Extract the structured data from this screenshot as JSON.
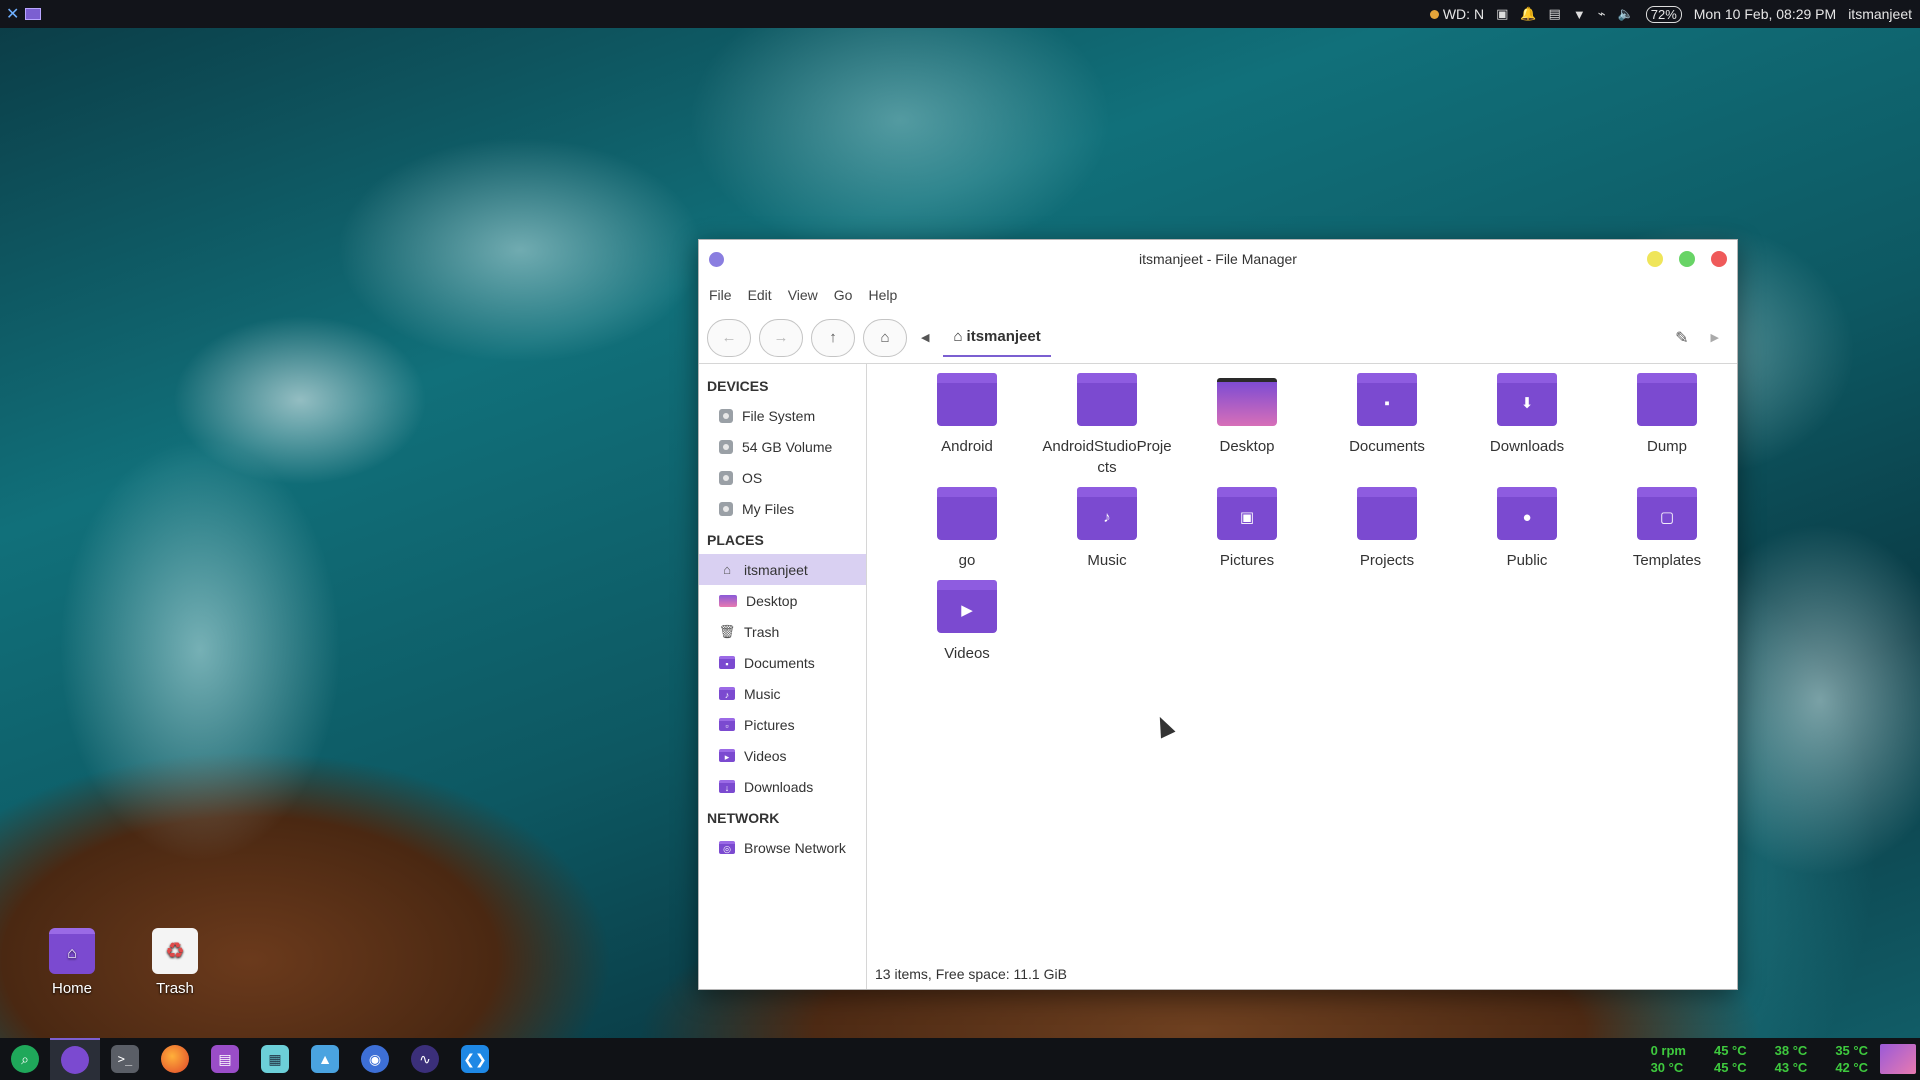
{
  "top_panel": {
    "weather": "WD: N",
    "battery": "72%",
    "clock": "Mon 10 Feb, 08:29 PM",
    "user": "itsmanjeet"
  },
  "desktop_icons": [
    {
      "label": "Home"
    },
    {
      "label": "Trash"
    }
  ],
  "window": {
    "title": "itsmanjeet - File Manager",
    "menu": [
      "File",
      "Edit",
      "View",
      "Go",
      "Help"
    ],
    "path": "itsmanjeet",
    "sidebar": {
      "devices_heading": "DEVICES",
      "devices": [
        "File System",
        "54 GB Volume",
        "OS",
        "My Files"
      ],
      "places_heading": "PLACES",
      "places": [
        "itsmanjeet",
        "Desktop",
        "Trash",
        "Documents",
        "Music",
        "Pictures",
        "Videos",
        "Downloads"
      ],
      "network_heading": "NETWORK",
      "network": [
        "Browse Network"
      ]
    },
    "files": [
      "Android",
      "AndroidStudioProjects",
      "Desktop",
      "Documents",
      "Downloads",
      "Dump",
      "go",
      "Music",
      "Pictures",
      "Projects",
      "Public",
      "Templates",
      "Videos"
    ],
    "status": "13 items, Free space: 11.1 GiB"
  },
  "sensors": [
    "0 rpm",
    "45 °C",
    "38 °C",
    "35 °C",
    "30 °C",
    "45 °C",
    "43 °C",
    "42 °C"
  ]
}
